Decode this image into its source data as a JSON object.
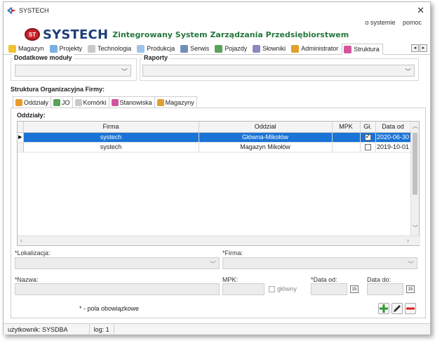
{
  "window": {
    "title": "SYSTECH",
    "close_glyph": "✕"
  },
  "top_links": {
    "about": "o systemie",
    "help": "pomoc"
  },
  "brand": {
    "logo_text": "ST",
    "name": "SYSTECH",
    "subtitle": "Zintegrowany System Zarządzania Przedsiębiorstwem"
  },
  "menu": {
    "tabs": [
      {
        "label": "Magazyn",
        "icon": "smiley-icon",
        "color": "#f2c230"
      },
      {
        "label": "Projekty",
        "icon": "document-icon",
        "color": "#7ab0e0"
      },
      {
        "label": "Technologia",
        "icon": "page-icon",
        "color": "#c9c9c9"
      },
      {
        "label": "Produkcja",
        "icon": "chart-icon",
        "color": "#9ec5e8"
      },
      {
        "label": "Serwis",
        "icon": "tools-icon",
        "color": "#6f8fb8"
      },
      {
        "label": "Pojazdy",
        "icon": "vehicle-icon",
        "color": "#5aa25a"
      },
      {
        "label": "Słowniki",
        "icon": "book-icon",
        "color": "#8a8ac0"
      },
      {
        "label": "Administrator",
        "icon": "admin-icon",
        "color": "#e0a030"
      },
      {
        "label": "Struktura",
        "icon": "structure-icon",
        "color": "#d2559c"
      }
    ],
    "active": "Struktura"
  },
  "modules": {
    "label": "Dodatkowe moduły",
    "value": ""
  },
  "reports": {
    "label": "Raporty",
    "value": ""
  },
  "structure": {
    "title": "Struktura Organizacyjna Firmy:",
    "tabs": [
      {
        "label": "Oddziały",
        "icon": "branches-icon",
        "color": "#e89b2a"
      },
      {
        "label": "JO",
        "icon": "unit-icon",
        "color": "#5aa25a"
      },
      {
        "label": "Komórki",
        "icon": "cells-icon",
        "color": "#c9c9c9"
      },
      {
        "label": "Stanowiska",
        "icon": "positions-icon",
        "color": "#d2559c"
      },
      {
        "label": "Magazyny",
        "icon": "warehouse-icon",
        "color": "#e0a030"
      }
    ],
    "active_tab": "Oddziały"
  },
  "branches": {
    "title": "Oddziały:",
    "columns": [
      "Firma",
      "Oddział",
      "MPK",
      "Gł.",
      "Data od"
    ],
    "rows": [
      {
        "firma": "systech",
        "oddzial": "Główna-Mikołów",
        "mpk": "",
        "glowny": true,
        "data_od": "2020-06-30",
        "selected": true
      },
      {
        "firma": "systech",
        "oddzial": "Magazyn Mikołów",
        "mpk": "",
        "glowny": false,
        "data_od": "2019-10-01",
        "selected": false
      }
    ]
  },
  "form": {
    "location_label": "*Lokalizacja:",
    "company_label": "*Firma:",
    "name_label": "*Nazwa:",
    "mpk_label": "MPK:",
    "main_label": "główny",
    "date_from_label": "*Data od:",
    "date_to_label": "Data do:",
    "required_note": "* - pola obowiązkowe"
  },
  "actions": {
    "add": "+",
    "edit": "✎",
    "delete": "−"
  },
  "status": {
    "user_label": "użytkownik:",
    "user_value": "SYSDBA",
    "log_label": "log:",
    "log_value": "1"
  }
}
